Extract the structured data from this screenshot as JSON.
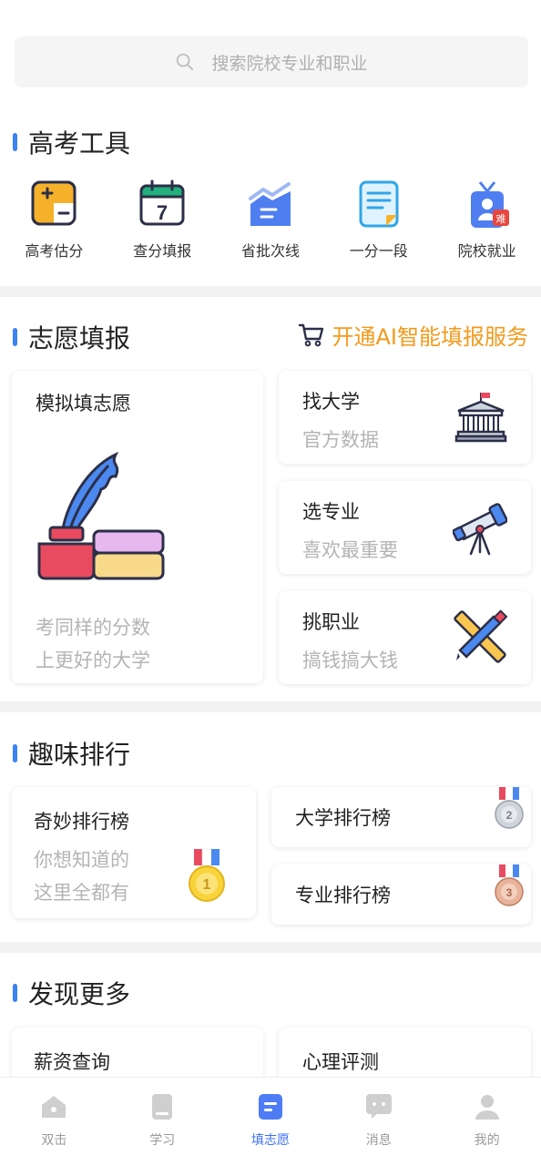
{
  "search": {
    "placeholder": "搜索院校专业和职业"
  },
  "sections": {
    "tools": {
      "title": "高考工具"
    },
    "volunteer": {
      "title": "志愿填报",
      "ai_link": "开通AI智能填报服务"
    },
    "ranking": {
      "title": "趣味排行"
    },
    "discover": {
      "title": "发现更多"
    }
  },
  "tools": [
    {
      "label": "高考估分",
      "icon": "score-estimate-icon"
    },
    {
      "label": "查分填报",
      "icon": "calendar-7-icon"
    },
    {
      "label": "省批次线",
      "icon": "batch-line-icon"
    },
    {
      "label": "一分一段",
      "icon": "document-icon"
    },
    {
      "label": "院校就业",
      "icon": "employee-badge-icon"
    }
  ],
  "volunteer_cards": {
    "simulate": {
      "title": "模拟填志愿",
      "line1": "考同样的分数",
      "line2": "上更好的大学"
    },
    "university": {
      "title": "找大学",
      "subtitle": "官方数据"
    },
    "major": {
      "title": "选专业",
      "subtitle": "喜欢最重要"
    },
    "career": {
      "title": "挑职业",
      "subtitle": "搞钱搞大钱"
    }
  },
  "ranking_cards": {
    "wonder": {
      "title": "奇妙排行榜",
      "line1": "你想知道的",
      "line2": "这里全都有",
      "medal": "1"
    },
    "university": {
      "title": "大学排行榜",
      "medal": "2"
    },
    "major": {
      "title": "专业排行榜",
      "medal": "3"
    }
  },
  "discover_cards": {
    "salary": {
      "title": "薪资查询"
    },
    "psych": {
      "title": "心理评测"
    }
  },
  "tabbar": [
    {
      "label": "双击",
      "icon": "home-icon",
      "active": false
    },
    {
      "label": "学习",
      "icon": "book-icon",
      "active": false
    },
    {
      "label": "填志愿",
      "icon": "form-icon",
      "active": true
    },
    {
      "label": "消息",
      "icon": "message-icon",
      "active": false
    },
    {
      "label": "我的",
      "icon": "profile-icon",
      "active": false
    }
  ],
  "colors": {
    "accent": "#3b82f6",
    "ai_orange": "#f39a1b",
    "tab_active": "#3b6ff5"
  }
}
